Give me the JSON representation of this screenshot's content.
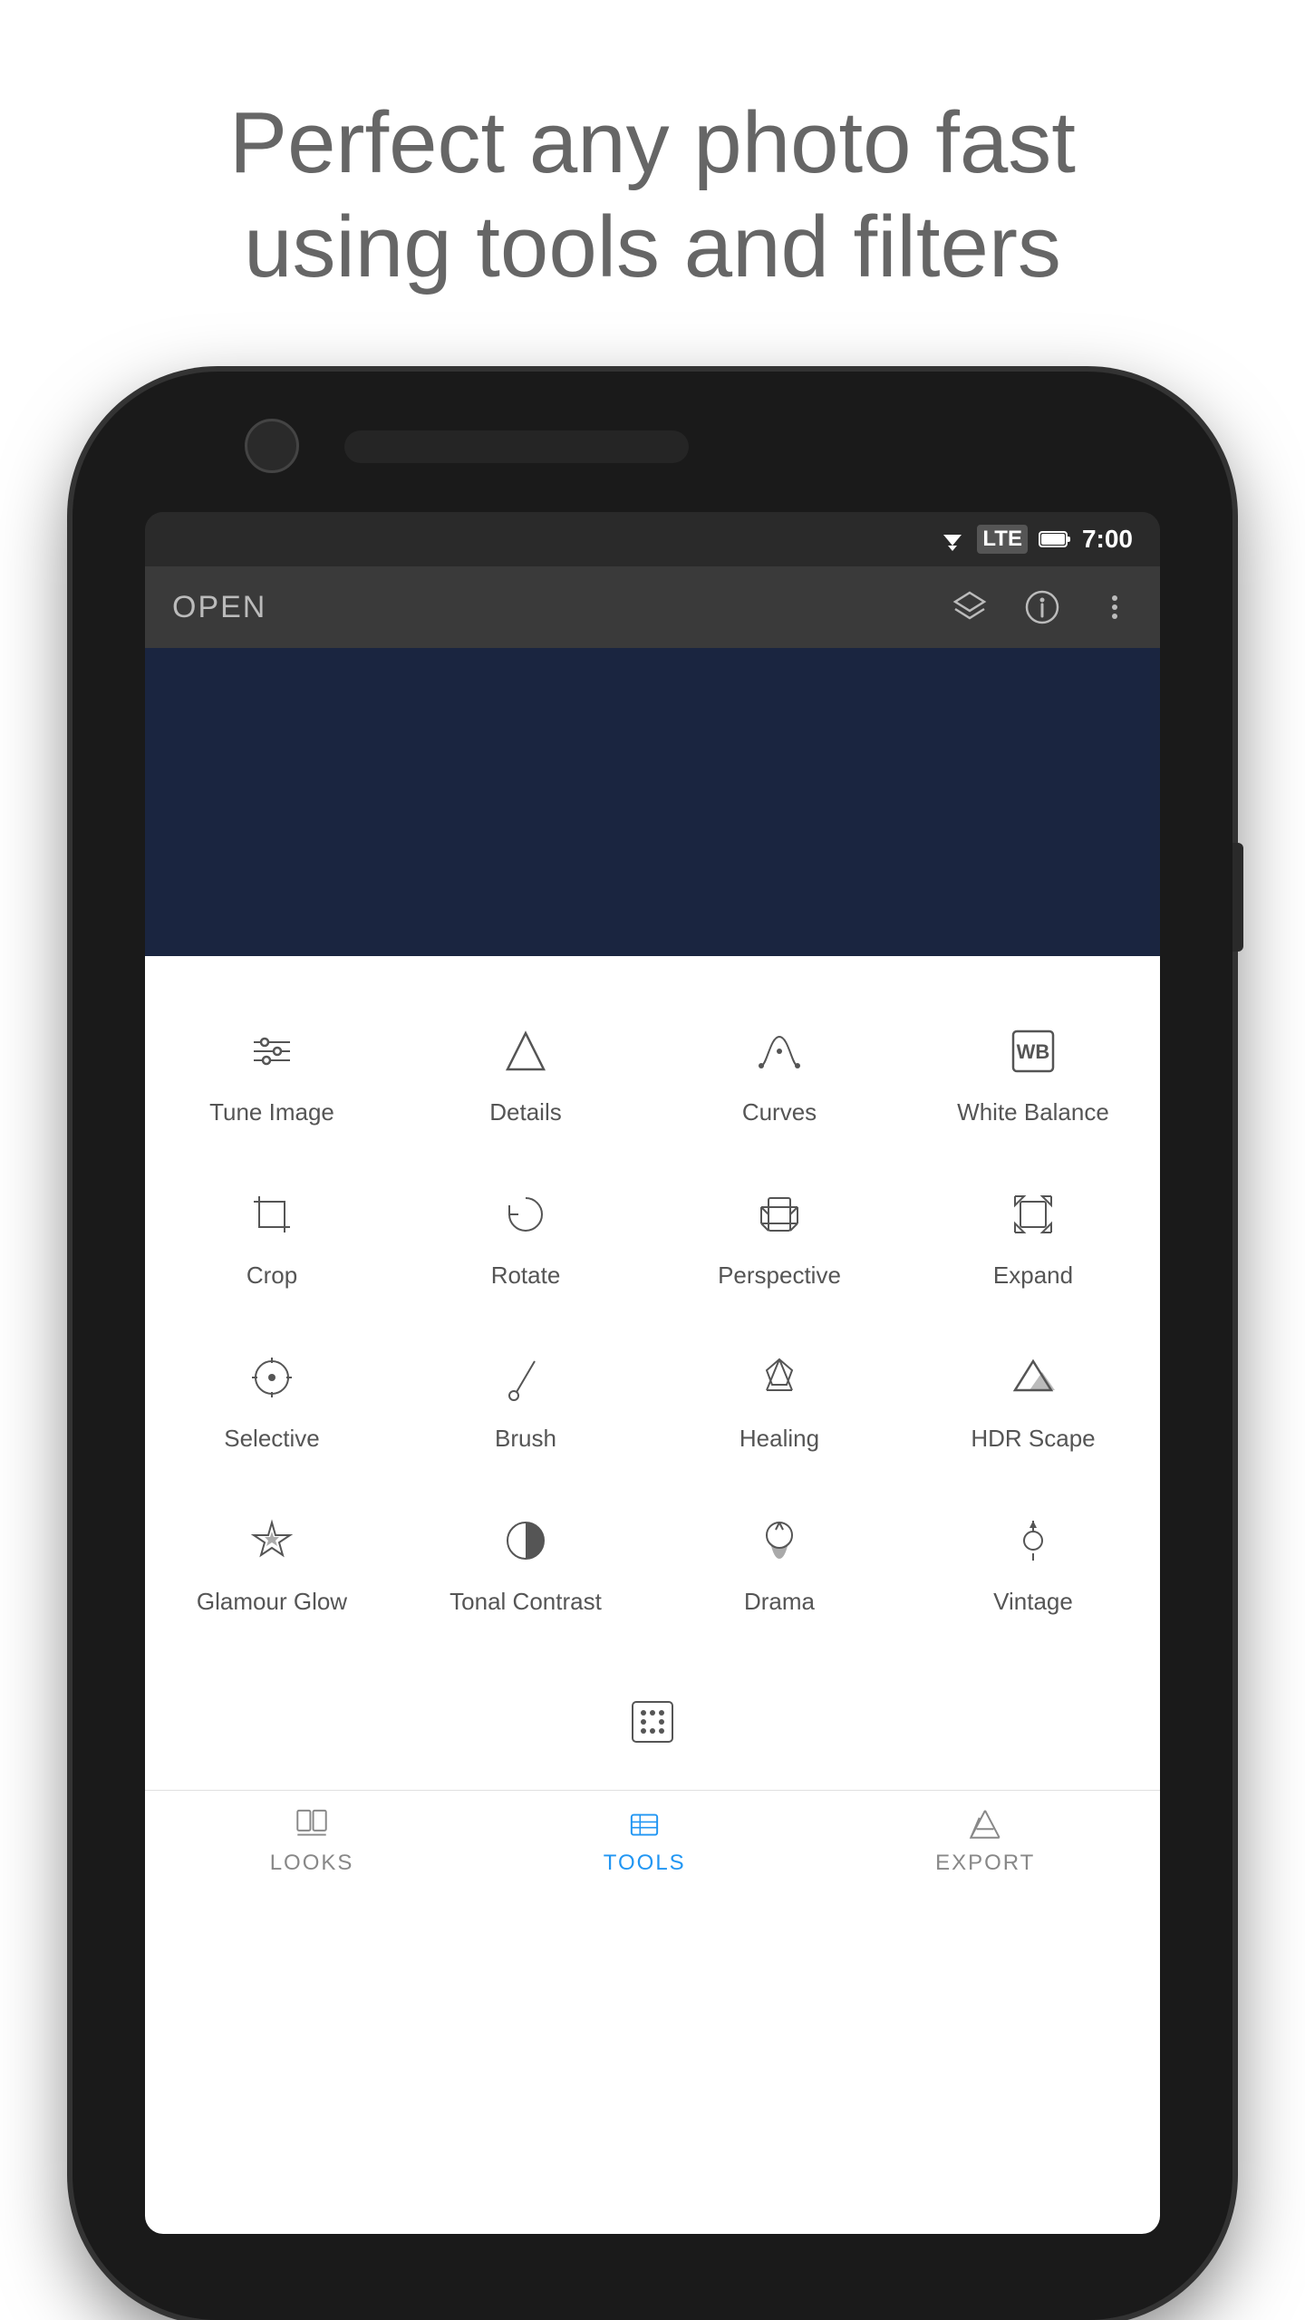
{
  "hero": {
    "line1": "Perfect any photo fast",
    "line2": "using tools and filters"
  },
  "statusBar": {
    "time": "7:00",
    "wifi": "▼",
    "lte": "LTE",
    "battery": "🔋"
  },
  "appBar": {
    "openLabel": "OPEN",
    "icons": [
      "layers",
      "info",
      "more"
    ]
  },
  "toolsGrid": [
    {
      "id": "tune-image",
      "label": "Tune Image",
      "icon": "tune"
    },
    {
      "id": "details",
      "label": "Details",
      "icon": "details"
    },
    {
      "id": "curves",
      "label": "Curves",
      "icon": "curves"
    },
    {
      "id": "white-balance",
      "label": "White Balance",
      "icon": "wb"
    },
    {
      "id": "crop",
      "label": "Crop",
      "icon": "crop"
    },
    {
      "id": "rotate",
      "label": "Rotate",
      "icon": "rotate"
    },
    {
      "id": "perspective",
      "label": "Perspective",
      "icon": "perspective"
    },
    {
      "id": "expand",
      "label": "Expand",
      "icon": "expand"
    },
    {
      "id": "selective",
      "label": "Selective",
      "icon": "selective"
    },
    {
      "id": "brush",
      "label": "Brush",
      "icon": "brush"
    },
    {
      "id": "healing",
      "label": "Healing",
      "icon": "healing"
    },
    {
      "id": "hdr-scape",
      "label": "HDR Scape",
      "icon": "hdr"
    },
    {
      "id": "glamour-glow",
      "label": "Glamour Glow",
      "icon": "glamour"
    },
    {
      "id": "tonal-contrast",
      "label": "Tonal Contrast",
      "icon": "tonal"
    },
    {
      "id": "drama",
      "label": "Drama",
      "icon": "drama"
    },
    {
      "id": "vintage",
      "label": "Vintage",
      "icon": "vintage"
    }
  ],
  "bottomNav": [
    {
      "id": "looks",
      "label": "LOOKS",
      "active": false
    },
    {
      "id": "tools",
      "label": "TOOLS",
      "active": true
    },
    {
      "id": "export",
      "label": "EXPORT",
      "active": false
    }
  ]
}
